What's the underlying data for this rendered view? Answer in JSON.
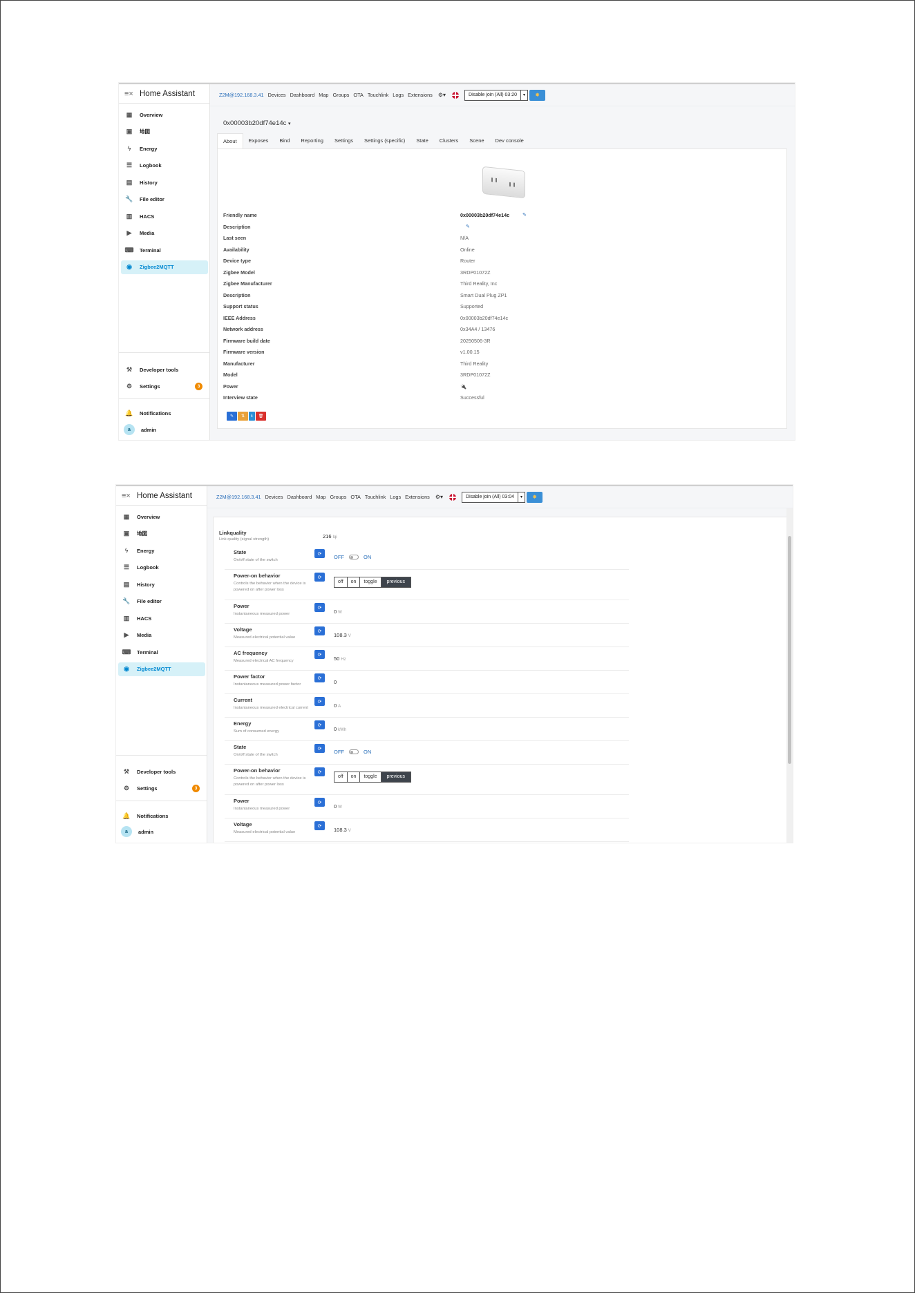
{
  "screenshots": [
    {
      "sidebar": {
        "title": "Home Assistant",
        "menu_icon": "menu-collapse-icon",
        "items": [
          {
            "label": "Overview",
            "icon": "dashboard-icon"
          },
          {
            "label": "地図",
            "icon": "map-icon"
          },
          {
            "label": "Energy",
            "icon": "lightning-icon"
          },
          {
            "label": "Logbook",
            "icon": "list-icon"
          },
          {
            "label": "History",
            "icon": "chart-icon"
          },
          {
            "label": "File editor",
            "icon": "wrench-icon"
          },
          {
            "label": "HACS",
            "icon": "hacs-icon"
          },
          {
            "label": "Media",
            "icon": "media-icon"
          },
          {
            "label": "Terminal",
            "icon": "terminal-icon"
          },
          {
            "label": "Zigbee2MQTT",
            "icon": "zigbee-icon",
            "active": true
          }
        ],
        "bottom": {
          "developer_tools": "Developer tools",
          "settings": "Settings",
          "settings_badge": "3",
          "notifications": "Notifications",
          "user_initial": "a",
          "user": "admin"
        }
      },
      "topbar": {
        "brand": "Z2M@192.168.3.41",
        "nav": [
          "Devices",
          "Dashboard",
          "Map",
          "Groups",
          "OTA",
          "Touchlink",
          "Logs",
          "Extensions"
        ],
        "join_label": "Disable join (All) 03:20"
      },
      "device_title": "0x00003b20df74e14c",
      "tabs": [
        "About",
        "Exposes",
        "Bind",
        "Reporting",
        "Settings",
        "Settings (specific)",
        "State",
        "Clusters",
        "Scene",
        "Dev console"
      ],
      "active_tab": "About",
      "about": [
        {
          "label": "Friendly name",
          "value": "0x00003b20df74e14c",
          "type": "bold-edit"
        },
        {
          "label": "Description",
          "value": "",
          "type": "edit"
        },
        {
          "label": "Last seen",
          "value": "N/A"
        },
        {
          "label": "Availability",
          "value": "Online"
        },
        {
          "label": "Device type",
          "value": "Router"
        },
        {
          "label": "Zigbee Model",
          "value": "3RDP01072Z"
        },
        {
          "label": "Zigbee Manufacturer",
          "value": "Third Reality, Inc"
        },
        {
          "label": "Description",
          "value": "Smart Dual Plug ZP1"
        },
        {
          "label": "Support status",
          "value": "Supported",
          "type": "green"
        },
        {
          "label": "IEEE Address",
          "value": "0x00003b20df74e14c"
        },
        {
          "label": "Network address",
          "value": "0x34A4 / 13476"
        },
        {
          "label": "Firmware build date",
          "value": "20250506-3R"
        },
        {
          "label": "Firmware version",
          "value": "v1.00.15"
        },
        {
          "label": "Manufacturer",
          "value": "Third Reality",
          "type": "link"
        },
        {
          "label": "Model",
          "value": "3RDP01072Z",
          "type": "link"
        },
        {
          "label": "Power",
          "value": "🔌",
          "type": "icon"
        },
        {
          "label": "Interview state",
          "value": "Successful"
        }
      ]
    },
    {
      "topbar": {
        "join_label": "Disable join (All) 03:04"
      },
      "linkquality": {
        "name": "Linkquality",
        "desc": "Link quality (signal strength)",
        "value": "216",
        "unit": "lqi"
      },
      "exposes": [
        {
          "name": "State",
          "desc": "On/off state of the switch",
          "type": "switch",
          "off": "OFF",
          "on": "ON"
        },
        {
          "name": "Power-on behavior",
          "desc": "Controls the behavior when the device is powered on after power loss",
          "type": "enum",
          "options": [
            "off",
            "on",
            "toggle",
            "previous"
          ],
          "selected": "previous"
        },
        {
          "name": "Power",
          "desc": "Instantaneous measured power",
          "value": "0",
          "unit": "W"
        },
        {
          "name": "Voltage",
          "desc": "Measured electrical potential value",
          "value": "108.3",
          "unit": "V"
        },
        {
          "name": "AC frequency",
          "desc": "Measured electrical AC frequency",
          "value": "50",
          "unit": "Hz"
        },
        {
          "name": "Power factor",
          "desc": "Instantaneous measured power factor",
          "value": "0",
          "unit": ""
        },
        {
          "name": "Current",
          "desc": "Instantaneous measured electrical current",
          "value": "0",
          "unit": "A"
        },
        {
          "name": "Energy",
          "desc": "Sum of consumed energy",
          "value": "0",
          "unit": "kWh"
        },
        {
          "name": "State",
          "desc": "On/off state of the switch",
          "type": "switch",
          "off": "OFF",
          "on": "ON"
        },
        {
          "name": "Power-on behavior",
          "desc": "Controls the behavior when the device is powered on after power loss",
          "type": "enum",
          "options": [
            "off",
            "on",
            "toggle",
            "previous"
          ],
          "selected": "previous"
        },
        {
          "name": "Power",
          "desc": "Instantaneous measured power",
          "value": "0",
          "unit": "W"
        },
        {
          "name": "Voltage",
          "desc": "Measured electrical potential value",
          "value": "108.3",
          "unit": "V"
        }
      ]
    }
  ],
  "colors": {
    "accent": "#2a6fba",
    "active_bg": "#d6f1f8",
    "badge": "#f08a00",
    "supported": "#2e9d3a"
  }
}
